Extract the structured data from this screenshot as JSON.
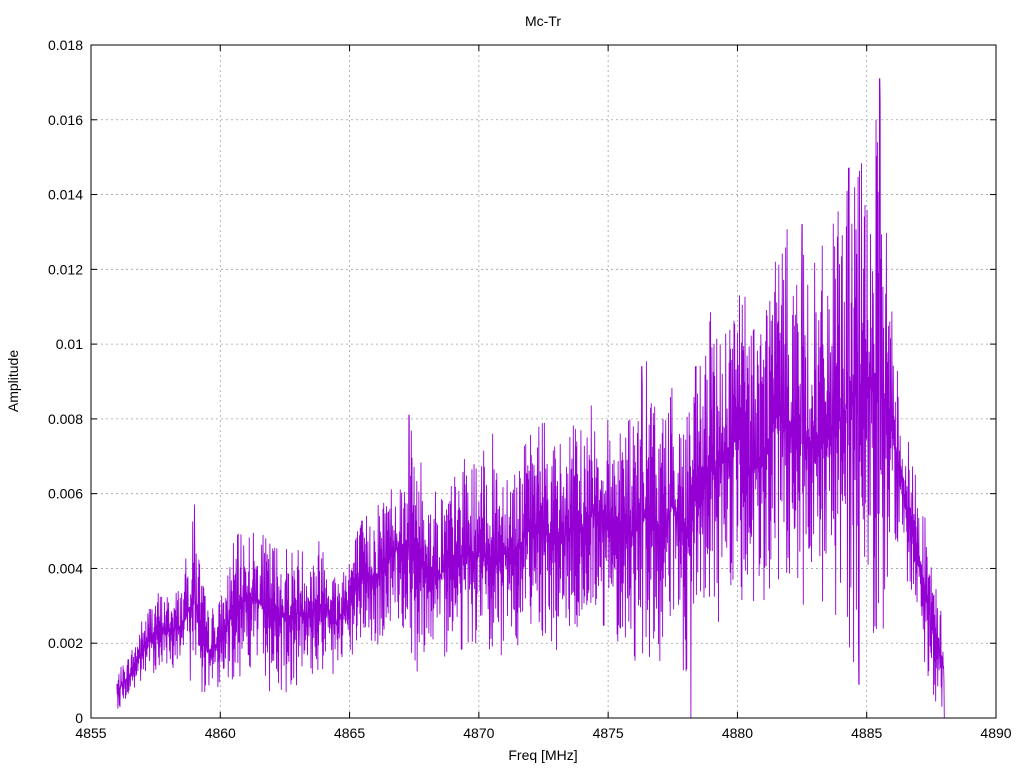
{
  "chart_data": {
    "type": "line",
    "title": "Mc-Tr",
    "xlabel": "Freq [MHz]",
    "ylabel": "Amplitude",
    "xlim": [
      4855,
      4890
    ],
    "ylim": [
      0,
      0.018
    ],
    "xticks": [
      4855,
      4860,
      4865,
      4870,
      4875,
      4880,
      4885,
      4890
    ],
    "yticks": [
      0,
      0.002,
      0.004,
      0.006,
      0.008,
      0.01,
      0.012,
      0.014,
      0.016,
      0.018
    ],
    "ytick_labels": [
      "0",
      "0.002",
      "0.004",
      "0.006",
      "0.008",
      "0.01",
      "0.012",
      "0.014",
      "0.016",
      "0.018"
    ],
    "grid": true,
    "series_color": "#9400d3",
    "series": [
      {
        "x_start": 4856.0,
        "x_end": 4888.0,
        "envelope_x": [
          4856.0,
          4856.5,
          4857.0,
          4857.5,
          4858.0,
          4858.5,
          4859.0,
          4859.5,
          4860.0,
          4860.5,
          4861.0,
          4861.5,
          4862.0,
          4862.5,
          4863.0,
          4863.5,
          4864.0,
          4864.5,
          4865.0,
          4865.5,
          4866.0,
          4866.5,
          4867.0,
          4867.5,
          4868.0,
          4868.5,
          4869.0,
          4869.5,
          4870.0,
          4870.5,
          4871.0,
          4871.5,
          4872.0,
          4872.5,
          4873.0,
          4873.5,
          4874.0,
          4874.5,
          4875.0,
          4875.5,
          4876.0,
          4876.5,
          4877.0,
          4877.5,
          4878.0,
          4878.5,
          4879.0,
          4879.5,
          4880.0,
          4880.5,
          4881.0,
          4881.5,
          4882.0,
          4882.5,
          4883.0,
          4883.5,
          4884.0,
          4884.5,
          4885.0,
          4885.5,
          4886.0,
          4886.5,
          4887.0,
          4887.5,
          4888.0
        ],
        "envelope_max": [
          0.0012,
          0.0018,
          0.0028,
          0.0035,
          0.0034,
          0.0037,
          0.0057,
          0.003,
          0.0033,
          0.0048,
          0.0054,
          0.005,
          0.005,
          0.0049,
          0.0048,
          0.0047,
          0.0052,
          0.004,
          0.005,
          0.0055,
          0.006,
          0.0065,
          0.0068,
          0.0082,
          0.0062,
          0.0064,
          0.0066,
          0.0072,
          0.007,
          0.0078,
          0.0074,
          0.0072,
          0.0078,
          0.0085,
          0.0076,
          0.008,
          0.0082,
          0.0087,
          0.0082,
          0.0087,
          0.0084,
          0.0098,
          0.0088,
          0.009,
          0.0094,
          0.0097,
          0.0112,
          0.0112,
          0.012,
          0.0118,
          0.0118,
          0.0133,
          0.0134,
          0.0128,
          0.0125,
          0.0132,
          0.0141,
          0.0162,
          0.0147,
          0.0171,
          0.011,
          0.008,
          0.0065,
          0.0045,
          0.0025
        ],
        "envelope_min": [
          0.0002,
          0.0005,
          0.0008,
          0.0012,
          0.0013,
          0.0012,
          0.0007,
          0.0005,
          0.0008,
          0.0009,
          0.0011,
          0.0012,
          0.0004,
          0.0005,
          0.0008,
          0.0009,
          0.001,
          0.001,
          0.0012,
          0.002,
          0.0015,
          0.0022,
          0.0024,
          0.0008,
          0.0019,
          0.0012,
          0.002,
          0.0015,
          0.0019,
          0.0008,
          0.0015,
          0.0018,
          0.0024,
          0.002,
          0.0015,
          0.0021,
          0.0018,
          0.0026,
          0.002,
          0.0018,
          0.0013,
          0.0014,
          0.0008,
          0.0025,
          0.0,
          0.0028,
          0.002,
          0.0025,
          0.0035,
          0.0013,
          0.0022,
          0.003,
          0.0025,
          0.002,
          0.0022,
          0.0022,
          0.002,
          0.001,
          0.003,
          0.001,
          0.0045,
          0.0035,
          0.0022,
          0.0005,
          0.0
        ],
        "peaks": [
          {
            "x": 4859.0,
            "y": 0.0057
          },
          {
            "x": 4867.3,
            "y": 0.0081
          },
          {
            "x": 4876.3,
            "y": 0.0094
          },
          {
            "x": 4882.5,
            "y": 0.0132
          },
          {
            "x": 4884.3,
            "y": 0.0147
          },
          {
            "x": 4884.7,
            "y": 0.0162
          },
          {
            "x": 4885.5,
            "y": 0.0171
          }
        ],
        "dips": [
          {
            "x": 4878.2,
            "y": 0.0
          },
          {
            "x": 4884.7,
            "y": 0.0009
          },
          {
            "x": 4888.0,
            "y": 0.0
          }
        ]
      }
    ]
  }
}
